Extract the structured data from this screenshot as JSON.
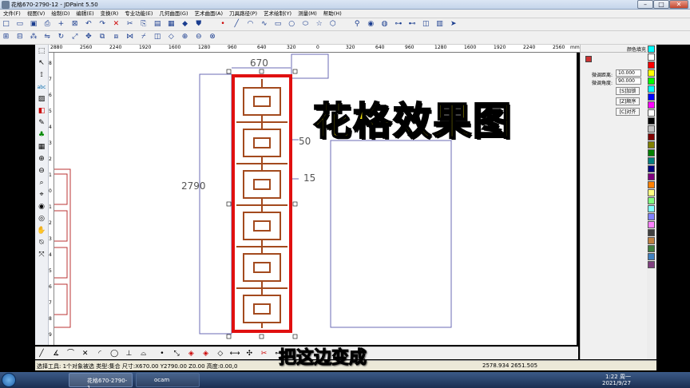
{
  "window": {
    "title": "花格670-2790-12 - JDPaint 5.50"
  },
  "menu": [
    "文件(F)",
    "视图(V)",
    "绘制(D)",
    "编辑(E)",
    "变换(R)",
    "专业功能(E)",
    "几何曲面(G)",
    "艺术曲面(A)",
    "刀具路径(P)",
    "艺术绘制(Y)",
    "测量(M)",
    "帮助(H)"
  ],
  "ruler_h": [
    "2880",
    "2560",
    "2240",
    "1920",
    "1600",
    "1280",
    "960",
    "640",
    "320",
    "0",
    "320",
    "640",
    "960",
    "1280",
    "1600",
    "1920",
    "2240",
    "2560",
    "mm"
  ],
  "ruler_v": [
    "8",
    "7",
    "6",
    "5",
    "4",
    "3",
    "2",
    "1",
    "0",
    "1",
    "2",
    "3",
    "4",
    "5",
    "6",
    "7",
    "8",
    "9"
  ],
  "dimensions": {
    "width": "670",
    "height": "2790",
    "d150": "50",
    "d15": "15"
  },
  "overlay_title": "花格效果图",
  "subtitle": "把这边变成",
  "right_panel": {
    "header": "颜色填充",
    "field1_label": "微调距离:",
    "field1_value": "10.000",
    "field2_label": "微调角度:",
    "field2_value": "90.000",
    "btn1": "[S]加锁",
    "btn2": "[Z]顺序",
    "btn3": "[C]对齐"
  },
  "palette_colors": [
    "#00ffff",
    "#ffffff",
    "#ff0000",
    "#ffff00",
    "#00ff00",
    "#00ffff",
    "#0000ff",
    "#ff00ff",
    "#ffffff",
    "#000000",
    "#c0c0c0",
    "#800000",
    "#808000",
    "#008000",
    "#008080",
    "#000080",
    "#800080",
    "#ff8000",
    "#ffff80",
    "#80ff80",
    "#80ffff",
    "#8080ff",
    "#ff80ff",
    "#404040",
    "#c08040",
    "#408040",
    "#4080c0",
    "#804080"
  ],
  "status": {
    "left": "选择工具: 1个对象被选  类型:集合  尺寸:X670.00 Y2790.00 Z0.00  高度:0.00,0",
    "coords": "2578.934 2651.505"
  },
  "taskbar": {
    "item1": "花格670-2790-1...",
    "item2": "ocam",
    "time": "1:22 周一",
    "date": "2021/9/27"
  }
}
